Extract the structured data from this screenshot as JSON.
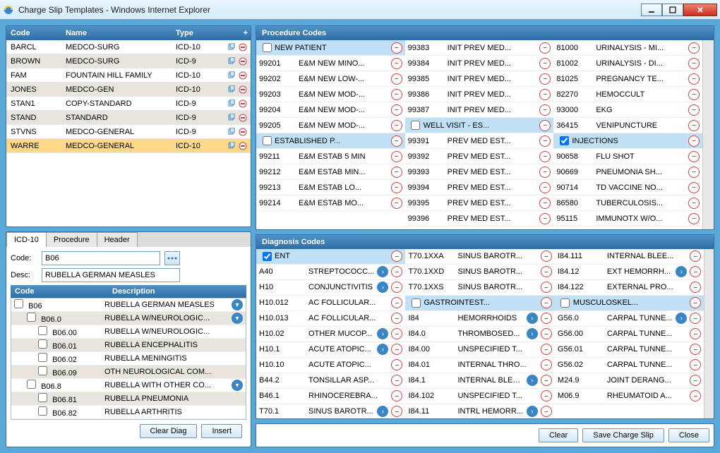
{
  "window": {
    "title": "Charge Slip Templates - Windows Internet Explorer"
  },
  "templates": {
    "headers": {
      "code": "Code",
      "name": "Name",
      "type": "Type"
    },
    "rows": [
      {
        "code": "BARCL",
        "name": "MEDCO-SURG",
        "type": "ICD-10",
        "alt": false
      },
      {
        "code": "BROWN",
        "name": "MEDCO-SURG",
        "type": "ICD-9",
        "alt": true
      },
      {
        "code": "FAM",
        "name": "FOUNTAIN HILL FAMILY",
        "type": "ICD-10",
        "alt": false
      },
      {
        "code": "JONES",
        "name": "MEDCO-GEN",
        "type": "ICD-10",
        "alt": true
      },
      {
        "code": "STAN1",
        "name": "COPY-STANDARD",
        "type": "ICD-9",
        "alt": false
      },
      {
        "code": "STAND",
        "name": "STANDARD",
        "type": "ICD-9",
        "alt": true
      },
      {
        "code": "STVNS",
        "name": "MEDCO-GENERAL",
        "type": "ICD-9",
        "alt": false
      },
      {
        "code": "WARRE",
        "name": "MEDCO-GENERAL",
        "type": "ICD-10",
        "sel": true
      }
    ]
  },
  "tabs": {
    "items": [
      "ICD-10",
      "Procedure",
      "Header"
    ],
    "active": 0
  },
  "lookup": {
    "code_label": "Code:",
    "code_value": "B06",
    "desc_label": "Desc:",
    "desc_value": "RUBELLA GERMAN MEASLES",
    "headers": {
      "code": "Code",
      "desc": "Description"
    },
    "rows": [
      {
        "code": "B06",
        "desc": "RUBELLA GERMAN MEASLES",
        "indent": 0,
        "expand": true,
        "alt": false
      },
      {
        "code": "B06.0",
        "desc": "RUBELLA W/NEUROLOGIC...",
        "indent": 1,
        "expand": true,
        "alt": true
      },
      {
        "code": "B06.00",
        "desc": "RUBELLA W/NEUROLOGIC...",
        "indent": 2,
        "alt": false
      },
      {
        "code": "B06.01",
        "desc": "RUBELLA ENCEPHALITIS",
        "indent": 2,
        "alt": true
      },
      {
        "code": "B06.02",
        "desc": "RUBELLA MENINGITIS",
        "indent": 2,
        "alt": false
      },
      {
        "code": "B06.09",
        "desc": "OTH NEUROLOGICAL COM...",
        "indent": 2,
        "alt": true
      },
      {
        "code": "B06.8",
        "desc": "RUBELLA WITH OTHER CO...",
        "indent": 1,
        "expand": true,
        "alt": false
      },
      {
        "code": "B06.81",
        "desc": "RUBELLA PNEUMONIA",
        "indent": 2,
        "alt": true
      },
      {
        "code": "B06.82",
        "desc": "RUBELLA ARTHRITIS",
        "indent": 2,
        "alt": false
      }
    ],
    "buttons": {
      "clear": "Clear Diag",
      "insert": "Insert"
    }
  },
  "procedures": {
    "title": "Procedure Codes",
    "cols": [
      [
        {
          "hdr": true,
          "desc": "NEW PATIENT"
        },
        {
          "code": "99201",
          "desc": "E&M NEW MINO..."
        },
        {
          "code": "99202",
          "desc": "E&M NEW LOW-..."
        },
        {
          "code": "99203",
          "desc": "E&M NEW MOD-..."
        },
        {
          "code": "99204",
          "desc": "E&M NEW MOD-..."
        },
        {
          "code": "99205",
          "desc": "E&M NEW MOD-..."
        },
        {
          "hdr": true,
          "desc": "ESTABLISHED P..."
        },
        {
          "code": "99211",
          "desc": "E&M ESTAB 5 MIN"
        },
        {
          "code": "99212",
          "desc": "E&M ESTAB MIN..."
        },
        {
          "code": "99213",
          "desc": "E&M ESTAB LO..."
        },
        {
          "code": "99214",
          "desc": "E&M ESTAB MO..."
        }
      ],
      [
        {
          "code": "99383",
          "desc": "INIT PREV MED..."
        },
        {
          "code": "99384",
          "desc": "INIT PREV MED..."
        },
        {
          "code": "99385",
          "desc": "INIT PREV MED..."
        },
        {
          "code": "99386",
          "desc": "INIT PREV MED..."
        },
        {
          "code": "99387",
          "desc": "INIT PREV MED..."
        },
        {
          "hdr": true,
          "desc": "WELL VISIT - ES..."
        },
        {
          "code": "99391",
          "desc": "PREV MED EST..."
        },
        {
          "code": "99392",
          "desc": "PREV MED EST..."
        },
        {
          "code": "99393",
          "desc": "PREV MED EST..."
        },
        {
          "code": "99394",
          "desc": "PREV MED EST..."
        },
        {
          "code": "99395",
          "desc": "PREV MED EST..."
        },
        {
          "code": "99396",
          "desc": "PREV MED EST..."
        }
      ],
      [
        {
          "code": "81000",
          "desc": "URINALYSIS - MI..."
        },
        {
          "code": "81002",
          "desc": "URINALYSIS - DI..."
        },
        {
          "code": "81025",
          "desc": "PREGNANCY TE..."
        },
        {
          "code": "82270",
          "desc": "HEMOCCULT"
        },
        {
          "code": "93000",
          "desc": "EKG"
        },
        {
          "code": "36415",
          "desc": "VENIPUNCTURE"
        },
        {
          "hdr": true,
          "checked": true,
          "desc": "INJECTIONS"
        },
        {
          "code": "90658",
          "desc": "FLU SHOT"
        },
        {
          "code": "90669",
          "desc": "PNEUMONIA SH..."
        },
        {
          "code": "90714",
          "desc": "TD VACCINE NO..."
        },
        {
          "code": "86580",
          "desc": "TUBERCULOSIS..."
        },
        {
          "code": "95115",
          "desc": "IMMUNOTX W/O..."
        }
      ]
    ]
  },
  "diagnoses": {
    "title": "Diagnosis Codes",
    "cols": [
      [
        {
          "hdr": true,
          "checked": true,
          "desc": "ENT"
        },
        {
          "code": "A40",
          "desc": "STREPTOCOCC...",
          "add": true
        },
        {
          "code": "H10",
          "desc": "CONJUNCTIVITIS",
          "add": true
        },
        {
          "code": "H10.012",
          "desc": "AC FOLLICULAR..."
        },
        {
          "code": "H10.013",
          "desc": "AC FOLLICULAR..."
        },
        {
          "code": "H10.02",
          "desc": "OTHER MUCOP...",
          "add": true
        },
        {
          "code": "H10.1",
          "desc": "ACUTE ATOPIC...",
          "add": true
        },
        {
          "code": "H10.10",
          "desc": "ACUTE ATOPIC..."
        },
        {
          "code": "B44.2",
          "desc": "TONSILLAR ASP..."
        },
        {
          "code": "B46.1",
          "desc": "RHINOCEREBRA..."
        },
        {
          "code": "T70.1",
          "desc": "SINUS BAROTR...",
          "add": true
        }
      ],
      [
        {
          "code": "T70.1XXA",
          "desc": "SINUS BAROTR..."
        },
        {
          "code": "T70.1XXD",
          "desc": "SINUS BAROTR..."
        },
        {
          "code": "T70.1XXS",
          "desc": "SINUS BAROTR..."
        },
        {
          "hdr": true,
          "desc": "GASTROINTEST..."
        },
        {
          "code": "I84",
          "desc": "HEMORRHOIDS",
          "add": true
        },
        {
          "code": "I84.0",
          "desc": "THROMBOSED...",
          "add": true
        },
        {
          "code": "I84.00",
          "desc": "UNSPECIFIED T..."
        },
        {
          "code": "I84.01",
          "desc": "INTERNAL THRO..."
        },
        {
          "code": "I84.1",
          "desc": "INTERNAL BLEE...",
          "add": true
        },
        {
          "code": "I84.102",
          "desc": "UNSPECIFIED T..."
        },
        {
          "code": "I84.11",
          "desc": "INTRL HEMORR...",
          "add": true
        }
      ],
      [
        {
          "code": "I84.111",
          "desc": "INTERNAL BLEE..."
        },
        {
          "code": "I84.12",
          "desc": "EXT HEMORRH...",
          "add": true
        },
        {
          "code": "I84.122",
          "desc": "EXTERNAL PRO..."
        },
        {
          "hdr": true,
          "desc": "MUSCULOSKEL..."
        },
        {
          "code": "G56.0",
          "desc": "CARPAL TUNNE...",
          "add": true
        },
        {
          "code": "G56.00",
          "desc": "CARPAL TUNNE..."
        },
        {
          "code": "G56.01",
          "desc": "CARPAL TUNNE..."
        },
        {
          "code": "G56.02",
          "desc": "CARPAL TUNNE..."
        },
        {
          "code": "M24.9",
          "desc": "JOINT DERANG..."
        },
        {
          "code": "M06.9",
          "desc": "RHEUMATOID A..."
        }
      ]
    ]
  },
  "footer": {
    "clear": "Clear",
    "save": "Save Charge Slip",
    "close": "Close"
  }
}
